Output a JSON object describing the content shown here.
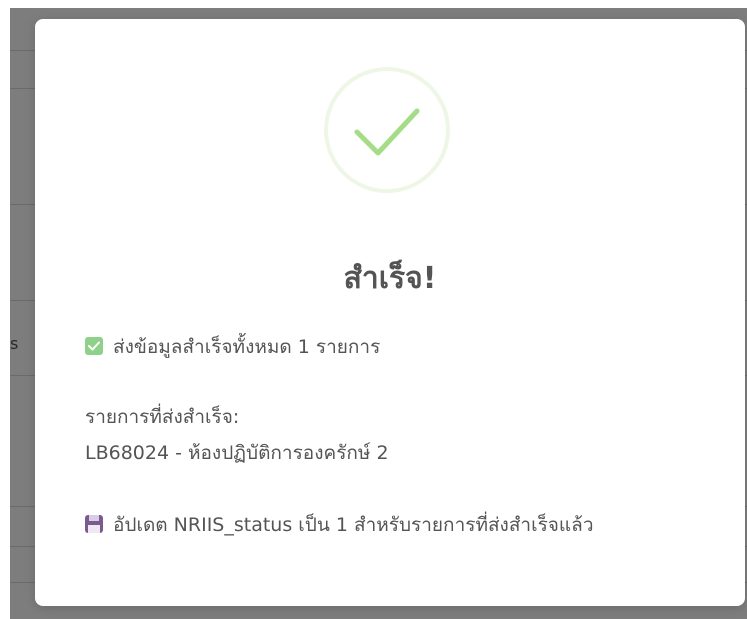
{
  "background": {
    "fragment_text": "s"
  },
  "dialog": {
    "icon": "check-circle-icon",
    "title": "สำเร็จ!",
    "summary_icon": "check-mark-button-icon",
    "summary": "ส่งข้อมูลสำเร็จทั้งหมด 1 รายการ",
    "list_label": "รายการที่ส่งสำเร็จ:",
    "items": [
      "LB68024 - ห้องปฏิบัติการองครักษ์ 2"
    ],
    "update_icon": "floppy-disk-icon",
    "update_note": "อัปเดต NRIIS_status เป็น 1 สำหรับรายการที่ส่งสำเร็จแล้ว"
  },
  "colors": {
    "success_green": "#a5dc86",
    "title_text": "#545454",
    "overlay": "#7d7d7d"
  }
}
